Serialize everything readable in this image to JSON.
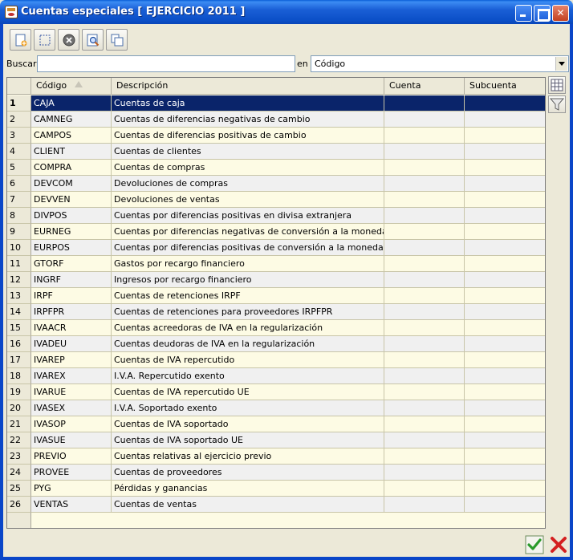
{
  "window": {
    "title": "Cuentas especiales [ EJERCICIO 2011 ]"
  },
  "toolbar": {
    "buttons": [
      "new-icon",
      "select-icon",
      "delete-icon",
      "preview-icon",
      "copy-icon"
    ]
  },
  "search": {
    "label": "Buscar",
    "value": "",
    "in_label": "en",
    "field": "Código"
  },
  "grid": {
    "columns": [
      "Código",
      "Descripción",
      "Cuenta",
      "Subcuenta"
    ],
    "rows": [
      {
        "n": "1",
        "codigo": "CAJA",
        "descripcion": "Cuentas de caja",
        "cuenta": "",
        "subcuenta": ""
      },
      {
        "n": "2",
        "codigo": "CAMNEG",
        "descripcion": "Cuentas de diferencias negativas de cambio",
        "cuenta": "",
        "subcuenta": ""
      },
      {
        "n": "3",
        "codigo": "CAMPOS",
        "descripcion": "Cuentas de diferencias positivas de cambio",
        "cuenta": "",
        "subcuenta": ""
      },
      {
        "n": "4",
        "codigo": "CLIENT",
        "descripcion": "Cuentas de clientes",
        "cuenta": "",
        "subcuenta": ""
      },
      {
        "n": "5",
        "codigo": "COMPRA",
        "descripcion": "Cuentas de compras",
        "cuenta": "",
        "subcuenta": ""
      },
      {
        "n": "6",
        "codigo": "DEVCOM",
        "descripcion": "Devoluciones de compras",
        "cuenta": "",
        "subcuenta": ""
      },
      {
        "n": "7",
        "codigo": "DEVVEN",
        "descripcion": "Devoluciones de ventas",
        "cuenta": "",
        "subcuenta": ""
      },
      {
        "n": "8",
        "codigo": "DIVPOS",
        "descripcion": "Cuentas por diferencias positivas en divisa extranjera",
        "cuenta": "",
        "subcuenta": ""
      },
      {
        "n": "9",
        "codigo": "EURNEG",
        "descripcion": "Cuentas por diferencias negativas de conversión a la moneda local",
        "cuenta": "",
        "subcuenta": ""
      },
      {
        "n": "10",
        "codigo": "EURPOS",
        "descripcion": "Cuentas por diferencias positivas de conversión a la moneda local",
        "cuenta": "",
        "subcuenta": ""
      },
      {
        "n": "11",
        "codigo": "GTORF",
        "descripcion": "Gastos por recargo financiero",
        "cuenta": "",
        "subcuenta": ""
      },
      {
        "n": "12",
        "codigo": "INGRF",
        "descripcion": "Ingresos por recargo financiero",
        "cuenta": "",
        "subcuenta": ""
      },
      {
        "n": "13",
        "codigo": "IRPF",
        "descripcion": "Cuentas de retenciones IRPF",
        "cuenta": "",
        "subcuenta": ""
      },
      {
        "n": "14",
        "codigo": "IRPFPR",
        "descripcion": "Cuentas de retenciones para proveedores IRPFPR",
        "cuenta": "",
        "subcuenta": ""
      },
      {
        "n": "15",
        "codigo": "IVAACR",
        "descripcion": "Cuentas acreedoras de IVA en la regularización",
        "cuenta": "",
        "subcuenta": ""
      },
      {
        "n": "16",
        "codigo": "IVADEU",
        "descripcion": "Cuentas deudoras de IVA en la regularización",
        "cuenta": "",
        "subcuenta": ""
      },
      {
        "n": "17",
        "codigo": "IVAREP",
        "descripcion": "Cuentas de IVA repercutido",
        "cuenta": "",
        "subcuenta": ""
      },
      {
        "n": "18",
        "codigo": "IVAREX",
        "descripcion": "I.V.A. Repercutido exento",
        "cuenta": "",
        "subcuenta": ""
      },
      {
        "n": "19",
        "codigo": "IVARUE",
        "descripcion": "Cuentas de IVA repercutido UE",
        "cuenta": "",
        "subcuenta": ""
      },
      {
        "n": "20",
        "codigo": "IVASEX",
        "descripcion": "I.V.A. Soportado exento",
        "cuenta": "",
        "subcuenta": ""
      },
      {
        "n": "21",
        "codigo": "IVASOP",
        "descripcion": "Cuentas de IVA soportado",
        "cuenta": "",
        "subcuenta": ""
      },
      {
        "n": "22",
        "codigo": "IVASUE",
        "descripcion": "Cuentas de IVA soportado UE",
        "cuenta": "",
        "subcuenta": ""
      },
      {
        "n": "23",
        "codigo": "PREVIO",
        "descripcion": "Cuentas relativas al ejercicio previo",
        "cuenta": "",
        "subcuenta": ""
      },
      {
        "n": "24",
        "codigo": "PROVEE",
        "descripcion": "Cuentas de proveedores",
        "cuenta": "",
        "subcuenta": ""
      },
      {
        "n": "25",
        "codigo": "PYG",
        "descripcion": "Pérdidas y ganancias",
        "cuenta": "",
        "subcuenta": ""
      },
      {
        "n": "26",
        "codigo": "VENTAS",
        "descripcion": "Cuentas de ventas",
        "cuenta": "",
        "subcuenta": ""
      }
    ],
    "selected_row": "1"
  },
  "side_buttons": [
    "grid-config-icon",
    "filter-icon"
  ],
  "actions": {
    "accept": "accept-icon",
    "cancel": "cancel-icon"
  },
  "colors": {
    "titlebar": "#0a46c8",
    "selection": "#0a246a",
    "grid_bg": "#fdfbe4",
    "alt_row": "#f0f0f0"
  }
}
